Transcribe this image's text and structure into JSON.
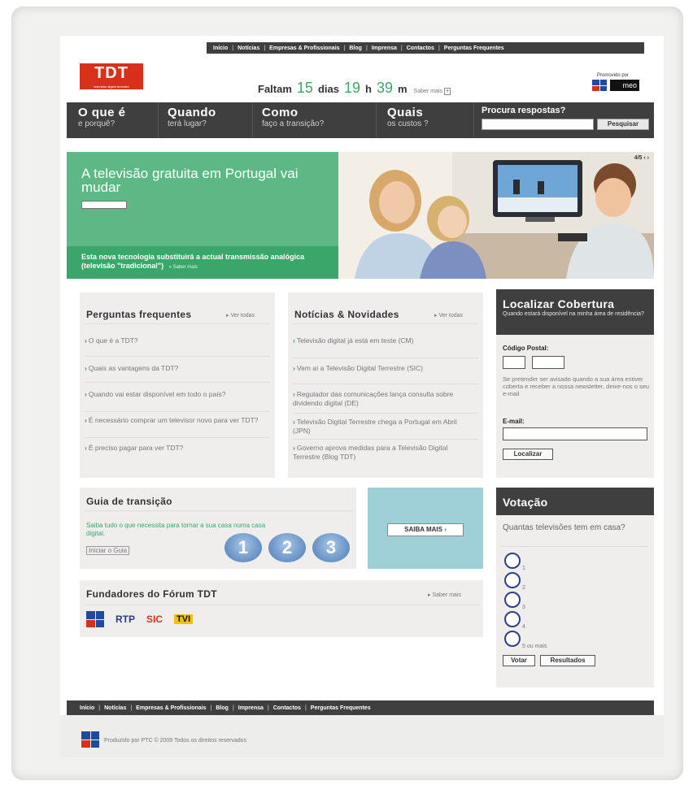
{
  "top_nav": [
    "Início",
    "Notícias",
    "Empresas & Profissionais",
    "Blog",
    "Imprensa",
    "Contactos",
    "Perguntas Frequentes"
  ],
  "logo": {
    "text": "TDT",
    "subtitle": "televisão digital terrestre"
  },
  "countdown": {
    "prefix": "Faltam",
    "days": "15",
    "days_label": "dias",
    "hours": "19",
    "hours_label": "h",
    "minutes": "39",
    "minutes_label": "m",
    "more": "Saber mais",
    "plus": "+"
  },
  "promoted_by": "Promovido por",
  "meo_label": "meo",
  "main_nav": [
    {
      "title": "O que é",
      "sub": "e porquê?"
    },
    {
      "title": "Quando",
      "sub": "terá lugar?"
    },
    {
      "title": "Como",
      "sub": "faço a transição?"
    },
    {
      "title": "Quais",
      "sub": "os custos ?"
    }
  ],
  "search": {
    "label": "Procura respostas?",
    "button": "Pesquisar",
    "value": ""
  },
  "hero": {
    "title": "A televisão gratuita em Portugal vai mudar",
    "band_text": "Esta nova tecnologia substituirá a actual transmissão analógica (televisão \"tradicional\")",
    "band_link": "» Saber mais",
    "counter": "4/5"
  },
  "faq": {
    "title": "Perguntas frequentes",
    "see_all": "▸ Ver todas",
    "items": [
      "O que é a TDT?",
      "Quais as vantagens da TDT?",
      "Quando vai estar disponível em todo o país?",
      "É necessário comprar um televisor novo para ver TDT?",
      "É preciso pagar para ver TDT?"
    ]
  },
  "news": {
    "title": "Notícias & Novidades",
    "see_all": "▸ Ver todas",
    "items": [
      "Televisão digital já está em teste (CM)",
      "Vem aí a Televisão Digital Terrestre (SIC)",
      "Regulador das comunicações lança consulta sobre dividendo digital (DE)",
      "Televisão Digital Terrestre chega a Portugal em Abril (JPN)",
      "Governo aprova medidas para a Televisão Digital Terrestre (Blog TDT)"
    ]
  },
  "coverage": {
    "title": "Localizar Cobertura",
    "subtitle": "Quando estará disponível na minha área de residência?",
    "postal_label": "Código Postal:",
    "info": "Se pretender ser avisado quando a sua área estiver coberta e receber a nossa newsletter, deixe-nos o seu e-mail",
    "email_label": "E-mail:",
    "button": "Localizar",
    "postal_a": "",
    "postal_b": "",
    "email_value": ""
  },
  "guide": {
    "title": "Guia de transição",
    "text": "Saiba tudo o que necessita para tornar a sua casa numa casa digital.",
    "link": "Iniciar o Guia",
    "steps": [
      "1",
      "2",
      "3"
    ],
    "cta": "SAIBA MAIS"
  },
  "founders": {
    "title": "Fundadores do Fórum TDT",
    "more": "▸ Saber mais",
    "logos": [
      "PT",
      "RTP",
      "SIC",
      "TVI"
    ]
  },
  "poll": {
    "title": "Votação",
    "question": "Quantas televisões tem em casa?",
    "options": [
      "1",
      "2",
      "3",
      "4",
      "5 ou mais"
    ],
    "vote": "Votar",
    "results": "Resultados"
  },
  "footer": {
    "text": "Produzido por PTC © 2009 Todos os direitos reservados"
  },
  "colors": {
    "green": "#5db885",
    "dark": "#3f3f3f",
    "red": "#d9301e"
  }
}
